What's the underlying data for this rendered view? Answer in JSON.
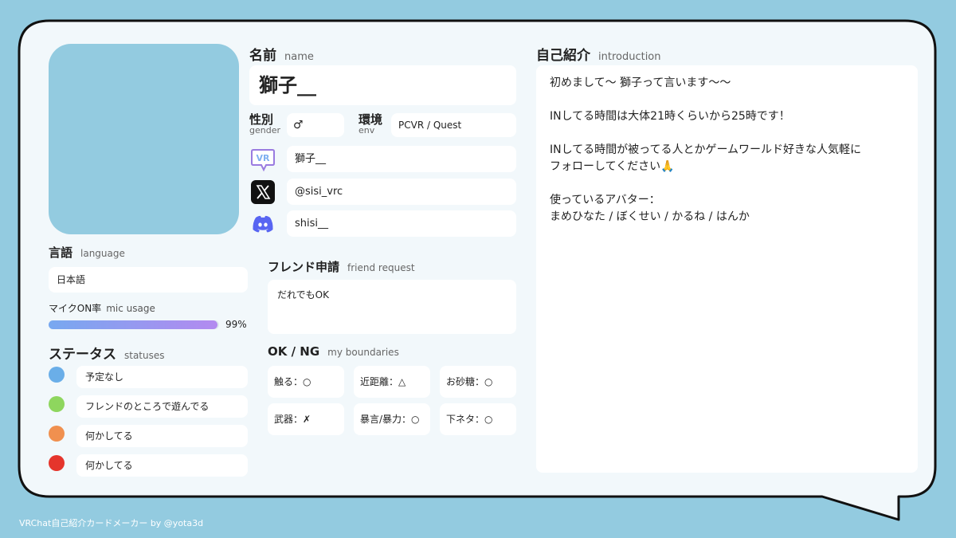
{
  "name": {
    "label": "名前",
    "sublabel": "name",
    "value": "獅子__"
  },
  "gender": {
    "label": "性別",
    "sublabel": "gender",
    "value": "♂"
  },
  "env": {
    "label": "環境",
    "sublabel": "env",
    "value": "PCVR / Quest"
  },
  "social": {
    "vrchat": {
      "icon": "vrchat-icon",
      "value": "獅子__"
    },
    "x": {
      "icon": "x-logo-icon",
      "value": "@sisi_vrc"
    },
    "discord": {
      "icon": "discord-icon",
      "value": "shisi__"
    }
  },
  "language": {
    "label": "言語",
    "sublabel": "language",
    "value": "日本語"
  },
  "mic": {
    "label": "マイクON率",
    "sublabel": "mic usage",
    "value_text": "99%",
    "fraction": 0.99
  },
  "statuses": {
    "label": "ステータス",
    "sublabel": "statuses",
    "items": [
      {
        "color": "#6aaee8",
        "text": "予定なし"
      },
      {
        "color": "#8ed65e",
        "text": "フレンドのところで遊んでる"
      },
      {
        "color": "#f0904f",
        "text": "何かしてる"
      },
      {
        "color": "#e5352c",
        "text": "何かしてる"
      }
    ]
  },
  "friend_request": {
    "label": "フレンド申請",
    "sublabel": "friend request",
    "value": "だれでもOK"
  },
  "okng": {
    "label": "OK / NG",
    "sublabel": "my boundaries",
    "items": [
      "触る：○",
      "近距離：△",
      "お砂糖：○",
      "武器：✗",
      "暴言/暴力：○",
      "下ネタ：○"
    ]
  },
  "introduction": {
    "label": "自己紹介",
    "sublabel": "introduction",
    "lines": [
      "初めまして〜 獅子って言います〜〜",
      "",
      "INしてる時間は大体21時くらいから25時です！",
      "",
      "INしてる時間が被ってる人とかゲームワールド好きな人気軽に",
      "フォローしてください🙏",
      "",
      "使っているアバター：",
      " まめひなた / ぼくせい / かるね / はんか"
    ]
  },
  "footer": "VRChat自己紹介カードメーカー by @yota3d",
  "colors": {
    "background": "#93cbe0",
    "card": "#f2f8fb",
    "mic_bar_start": "#77a8f0",
    "mic_bar_end": "#b38af0"
  }
}
